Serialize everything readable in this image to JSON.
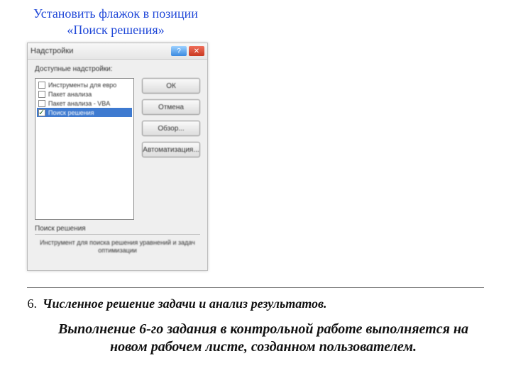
{
  "caption": {
    "line1": "Установить флажок в позиции",
    "line2": "«Поиск решения»"
  },
  "dialog": {
    "title": "Надстройки",
    "help_glyph": "?",
    "close_glyph": "✕",
    "available_label": "Доступные надстройки:",
    "items": [
      {
        "label": "Инструменты для евро",
        "checked": false,
        "selected": false
      },
      {
        "label": "Пакет анализа",
        "checked": false,
        "selected": false
      },
      {
        "label": "Пакет анализа - VBA",
        "checked": false,
        "selected": false
      },
      {
        "label": "Поиск решения",
        "checked": true,
        "selected": true
      }
    ],
    "buttons": {
      "ok": "ОК",
      "cancel": "Отмена",
      "browse": "Обзор...",
      "automation": "Автоматизация..."
    },
    "desc_title": "Поиск решения",
    "desc_body": "Инструмент для поиска решения уравнений и задач оптимизации"
  },
  "step": {
    "num": "6.",
    "title": "Численное решение задачи и анализ результатов."
  },
  "paragraph": "Выполнение 6-го задания в контрольной работе выполняется на новом рабочем листе, созданном пользователем."
}
